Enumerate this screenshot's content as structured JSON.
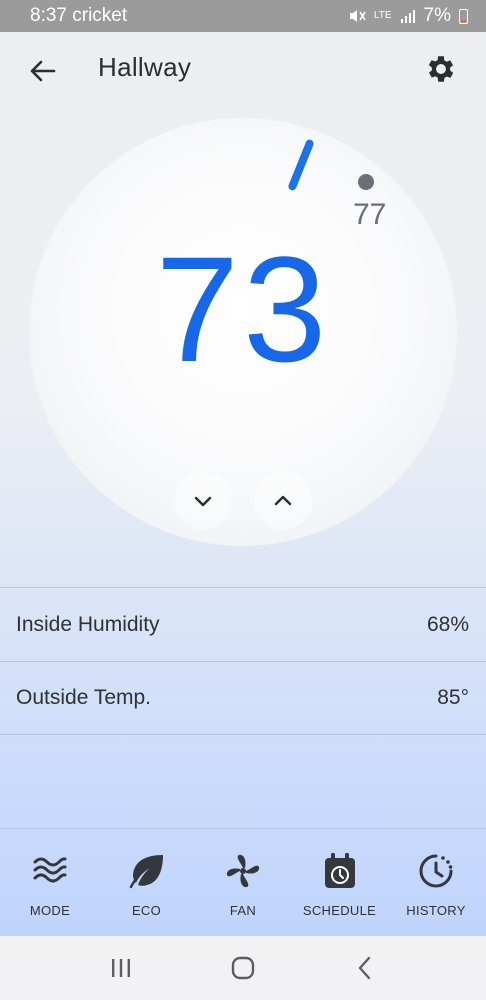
{
  "status_bar": {
    "time_carrier": "8:37 cricket",
    "network": "LTE",
    "battery": "7%"
  },
  "header": {
    "title": "Hallway",
    "back_icon": "arrow-left-icon",
    "settings_icon": "gear-icon"
  },
  "thermostat": {
    "target_temp": "73",
    "ambient_temp": "77",
    "accent_color": "#1668e8"
  },
  "info": {
    "humidity_label": "Inside Humidity",
    "humidity_value": "68%",
    "outside_label": "Outside Temp.",
    "outside_value": "85°"
  },
  "nav": {
    "items": [
      {
        "label": "MODE",
        "icon": "waves-icon"
      },
      {
        "label": "ECO",
        "icon": "leaf-icon"
      },
      {
        "label": "FAN",
        "icon": "fan-icon"
      },
      {
        "label": "SCHEDULE",
        "icon": "calendar-clock-icon"
      },
      {
        "label": "HISTORY",
        "icon": "history-icon"
      }
    ]
  },
  "system_nav": {
    "recents_icon": "recents-icon",
    "home_icon": "home-icon",
    "back_icon": "back-chevron-icon"
  }
}
